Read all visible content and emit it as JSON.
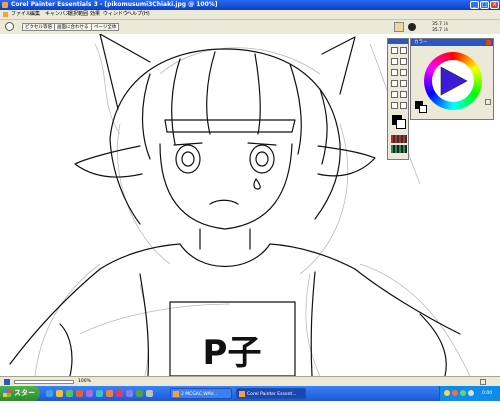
{
  "window": {
    "title": "Corel Painter Essentials 3 - [pikomusumi3Chiaki.jpg @ 100%]"
  },
  "menu": {
    "items": [
      "ファイル",
      "編集",
      "キャンバス",
      "選択範囲",
      "効果",
      "ウィンドウ",
      "ヘルプ(H)"
    ]
  },
  "toolbar": {
    "fit_pixels": "ピクセル等倍",
    "fit_screen": "画面に合わせる",
    "page_size": "ページ全体"
  },
  "right_toolbar": {
    "size_label": "35.7 ﾐﾙ",
    "opacity_label": "35.7 ﾐﾙ"
  },
  "color_panel": {
    "title": "カラー"
  },
  "drawing": {
    "shirt_text": "P子"
  },
  "status": {
    "zoom": "100%"
  },
  "taskbar": {
    "start_label": "スタート",
    "buttons": [
      "2 MCGAC.WAV...",
      "Corel Painter Essent..."
    ],
    "clock": "0:00"
  }
}
